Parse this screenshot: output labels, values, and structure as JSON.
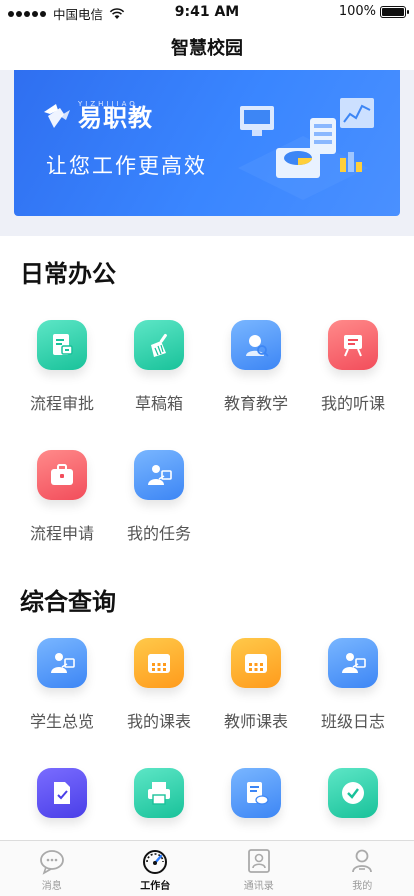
{
  "status_bar": {
    "carrier": "中国电信",
    "time": "9:41 AM",
    "battery": "100%"
  },
  "nav": {
    "title": "智慧校园"
  },
  "banner": {
    "brand": "易职教",
    "brand_sub": "YIZHIJIAO",
    "slogan": "让您工作更高效"
  },
  "sections": [
    {
      "title": "日常办公",
      "items": [
        {
          "label": "流程审批",
          "icon": "document-approve-icon",
          "color": "teal"
        },
        {
          "label": "草稿箱",
          "icon": "broom-icon",
          "color": "teal"
        },
        {
          "label": "教育教学",
          "icon": "teacher-search-icon",
          "color": "blue"
        },
        {
          "label": "我的听课",
          "icon": "easel-icon",
          "color": "red"
        },
        {
          "label": "流程申请",
          "icon": "briefcase-icon",
          "color": "red"
        },
        {
          "label": "我的任务",
          "icon": "person-board-icon",
          "color": "blue"
        }
      ]
    },
    {
      "title": "综合查询",
      "items": [
        {
          "label": "学生总览",
          "icon": "person-board-icon",
          "color": "blue"
        },
        {
          "label": "我的课表",
          "icon": "calendar-icon",
          "color": "orange"
        },
        {
          "label": "教师课表",
          "icon": "calendar-icon",
          "color": "orange"
        },
        {
          "label": "班级日志",
          "icon": "person-board-icon",
          "color": "blue"
        },
        {
          "label": "",
          "icon": "check-document-icon",
          "color": "purple"
        },
        {
          "label": "",
          "icon": "printer-icon",
          "color": "teal"
        },
        {
          "label": "",
          "icon": "cloud-document-icon",
          "color": "blue"
        },
        {
          "label": "",
          "icon": "shield-check-icon",
          "color": "teal"
        }
      ]
    }
  ],
  "tabs": [
    {
      "label": "消息",
      "icon": "chat-icon",
      "active": false
    },
    {
      "label": "工作台",
      "icon": "dashboard-gauge-icon",
      "active": true
    },
    {
      "label": "通讯录",
      "icon": "contacts-icon",
      "active": false
    },
    {
      "label": "我的",
      "icon": "profile-icon",
      "active": false
    }
  ],
  "colors": {
    "teal": "#19c29a",
    "blue": "#3d86f5",
    "red": "#f24d5b",
    "orange": "#ff9b1c",
    "purple": "#4a3fe8",
    "banner": "#3a86ff"
  }
}
